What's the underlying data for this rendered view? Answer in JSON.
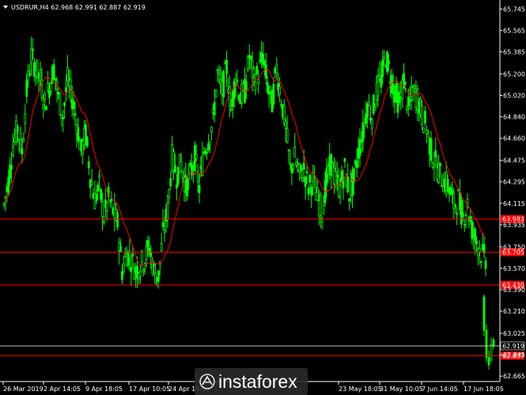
{
  "header": {
    "symbol_line": "USDRUR,H4  62.968 62.991 62.887 62.919"
  },
  "watermark": {
    "text": "instaforex"
  },
  "colors": {
    "background": "#000000",
    "candles": "#00ff00",
    "ma": "#ff0000",
    "levels": "#ff0000",
    "price_line": "#c0c0c0",
    "tag_bg": "#ff0000",
    "current_tag_bg": "#000000"
  },
  "chart_data": {
    "type": "candlestick",
    "title": "USDRUR,H4",
    "ohlc_current": {
      "open": 62.968,
      "high": 62.991,
      "low": 62.887,
      "close": 62.919
    },
    "ylim": [
      62.62,
      65.8
    ],
    "y_ticks": [
      "65.745",
      "65.565",
      "65.385",
      "65.200",
      "65.020",
      "64.840",
      "64.660",
      "64.475",
      "64.295",
      "64.115",
      "63.935",
      "63.750",
      "63.570",
      "63.390",
      "63.210",
      "63.025",
      "62.845",
      "62.665"
    ],
    "x_labels": [
      "26 Mar 2019",
      "2 Apr 14:05",
      "9 Apr 18:05",
      "17 Apr 10:05",
      "24 Apr 18:05",
      "23 May 18:05",
      "31 May 10:05",
      "7 Jun 14:05",
      "17 Jun 18:05"
    ],
    "current_price": "62.919",
    "levels": [
      {
        "value": 63.983,
        "label": "63.983"
      },
      {
        "value": 63.705,
        "label": "63.705"
      },
      {
        "value": 63.43,
        "label": "63.430"
      },
      {
        "value": 62.837,
        "label": "62.837"
      }
    ],
    "price_path": [
      64.1,
      64.3,
      64.6,
      64.75,
      64.55,
      65.05,
      65.35,
      65.25,
      65.15,
      64.95,
      65.1,
      65.25,
      65.0,
      64.85,
      65.15,
      65.0,
      64.8,
      64.55,
      64.7,
      64.35,
      64.15,
      64.25,
      64.0,
      64.15,
      64.05,
      63.95,
      63.55,
      63.7,
      63.65,
      63.55,
      63.6,
      63.65,
      63.75,
      63.55,
      63.5,
      63.85,
      64.05,
      64.5,
      64.35,
      64.45,
      64.25,
      64.35,
      64.5,
      64.25,
      64.55,
      64.65,
      64.8,
      65.2,
      65.05,
      65.25,
      64.9,
      65.2,
      65.0,
      65.05,
      65.35,
      65.15,
      65.2,
      65.35,
      65.1,
      64.95,
      65.25,
      65.0,
      64.75,
      64.4,
      64.5,
      64.35,
      64.4,
      64.25,
      64.3,
      64.15,
      64.05,
      64.3,
      64.45,
      64.3,
      64.25,
      64.4,
      64.2,
      64.3,
      64.55,
      64.7,
      64.95,
      64.85,
      65.05,
      65.15,
      65.35,
      65.2,
      65.05,
      64.95,
      65.15,
      64.9,
      65.05,
      65.0,
      64.85,
      64.75,
      64.55,
      64.45,
      64.35,
      64.3,
      64.25,
      64.1,
      64.15,
      64.0,
      64.1,
      63.9,
      63.8,
      63.7,
      63.65
    ]
  }
}
